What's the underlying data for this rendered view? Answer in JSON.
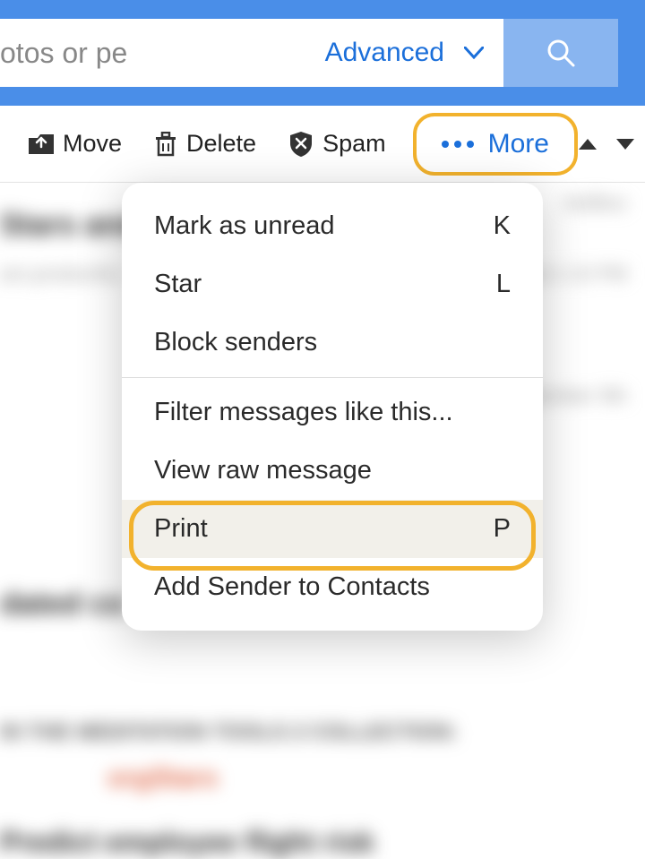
{
  "header": {
    "search_value": "otos or pe",
    "advanced_label": "Advanced"
  },
  "toolbar": {
    "move": "Move",
    "delete": "Delete",
    "spam": "Spam",
    "more": "More"
  },
  "menu": {
    "items": [
      {
        "label": "Mark as unread",
        "shortcut": "K"
      },
      {
        "label": "Star",
        "shortcut": "L"
      },
      {
        "label": "Block senders",
        "shortcut": ""
      }
    ],
    "items2": [
      {
        "label": "Filter messages like this...",
        "shortcut": ""
      },
      {
        "label": "View raw message",
        "shortcut": ""
      },
      {
        "label": "Print",
        "shortcut": "P",
        "hover": true
      },
      {
        "label": "Add Sender to Contacts",
        "shortcut": ""
      }
    ]
  },
  "blur": {
    "title": "Stars and I",
    "from": "am.producthu",
    "adbox": "Ad/Box",
    "date1": "9 at 1:10 PM",
    "date2": "ptember 9th",
    "heading2": "dated co",
    "line": "IN THE  MEDITATION TOOLS 2  COLLECTION:",
    "org": "orgStars",
    "bold": "Predict employee flight risk"
  }
}
